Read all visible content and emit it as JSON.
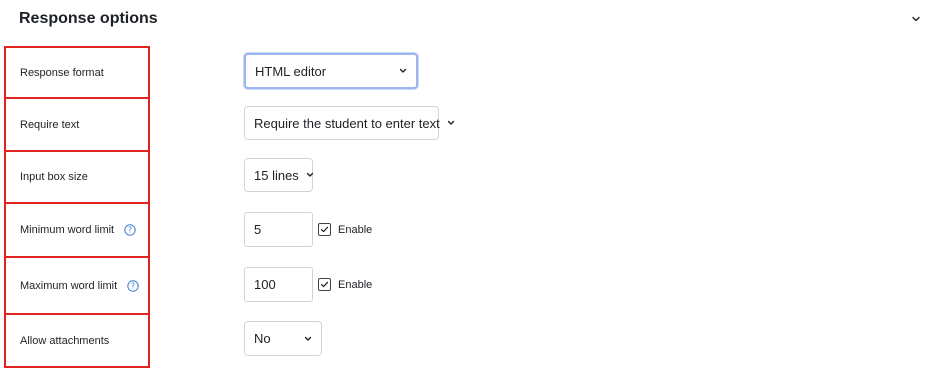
{
  "section": {
    "title": "Response options"
  },
  "rows": {
    "response_format": {
      "label": "Response format",
      "value": "HTML editor"
    },
    "require_text": {
      "label": "Require text",
      "value": "Require the student to enter text"
    },
    "input_box_size": {
      "label": "Input box size",
      "value": "15 lines"
    },
    "min_word_limit": {
      "label": "Minimum word limit",
      "value": "5",
      "enable_label": "Enable",
      "enabled": true
    },
    "max_word_limit": {
      "label": "Maximum word limit",
      "value": "100",
      "enable_label": "Enable",
      "enabled": true
    },
    "allow_attachments": {
      "label": "Allow attachments",
      "value": "No"
    }
  },
  "colors": {
    "highlight_border": "#e2221d",
    "help_icon": "#3a7bd5",
    "focus_border": "#9cb8ee"
  },
  "icons": {
    "collapse": "chevron-down-icon",
    "select_caret": "chevron-down-icon",
    "help": "question-circle-icon",
    "check": "checkmark-icon"
  }
}
